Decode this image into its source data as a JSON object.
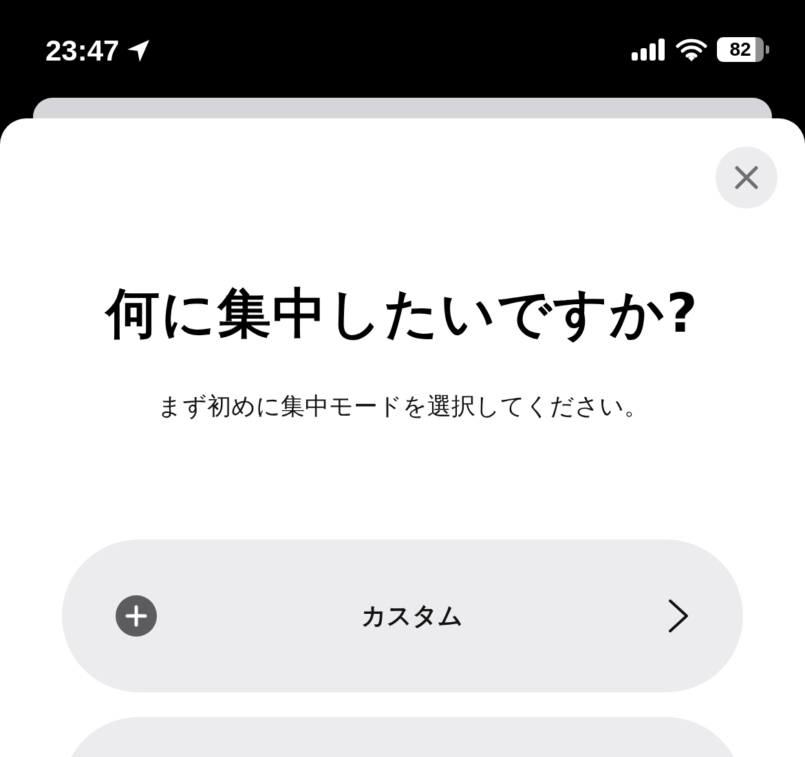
{
  "status_bar": {
    "time": "23:47",
    "battery": "82"
  },
  "sheet": {
    "title": "何に集中したいですか?",
    "subtitle": "まず初めに集中モードを選択してください。",
    "options": [
      {
        "label": "カスタム",
        "kind": "custom"
      },
      {
        "kind": "partial"
      }
    ]
  }
}
